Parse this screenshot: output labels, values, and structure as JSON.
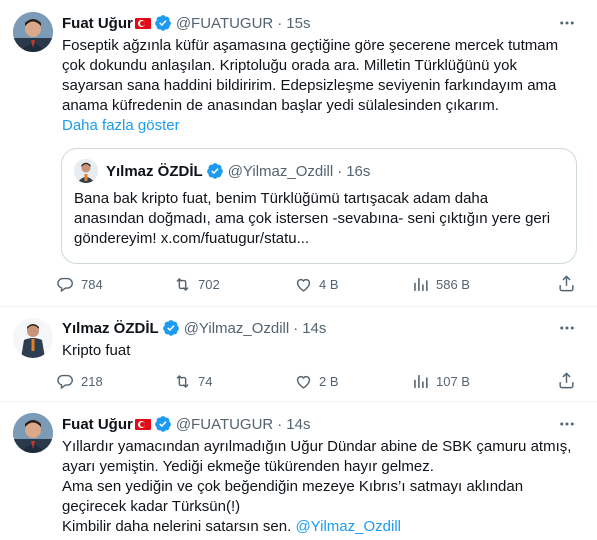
{
  "tweets": [
    {
      "name": "Fuat Uğur",
      "flag": true,
      "handle": "@FUATUGUR",
      "separator": "·",
      "time": "15s",
      "lines": [
        "Foseptik ağzınla küfür aşamasına geçtiğine göre şecerene mercek tutmam",
        "çok dokundu anlaşılan. Kriptoluğu orada ara.  Milletin Türklüğünü yok",
        "sayarsan sana haddini bildiririm. Edepsizleşme seviyenin farkındayım ama",
        "anama küfredenin de anasından başlar yedi sülalesinden çıkarım."
      ],
      "show_more": "Daha fazla göster",
      "quote": {
        "name": "Yılmaz ÖZDİL",
        "handle": "@Yilmaz_Ozdill",
        "separator": "·",
        "time": "16s",
        "lines": [
          "Bana bak kripto fuat, benim Türklüğümü tartışacak adam daha",
          "anasından doğmadı, ama çok istersen -sevabına- seni çıktığın yere geri",
          "göndereyim! x.com/fuatugur/statu..."
        ]
      },
      "stats": {
        "replies": "784",
        "reposts": "702",
        "likes": "4 B",
        "views": "586 B"
      }
    },
    {
      "name": "Yılmaz ÖZDİL",
      "handle": "@Yilmaz_Ozdill",
      "separator": "·",
      "time": "14s",
      "lines": [
        "Kripto fuat"
      ],
      "stats": {
        "replies": "218",
        "reposts": "74",
        "likes": "2 B",
        "views": "107 B"
      }
    },
    {
      "name": "Fuat Uğur",
      "flag": true,
      "handle": "@FUATUGUR",
      "separator": "·",
      "time": "14s",
      "lines": [
        "Yıllardır yamacından ayrılmadığın Uğur Dündar abine de SBK çamuru atmış,",
        "ayarı yemiştin. Yediği ekmeğe tükürenden hayır gelmez.",
        "Ama sen yediğin ve çok beğendiğin mezeye Kıbrıs’ı satmayı aklından",
        "geçirecek kadar Türksün(!)"
      ],
      "last_line_text": "Kimbilir daha nelerini satarsın sen. ",
      "last_line_mention": "@Yilmaz_Ozdill"
    }
  ],
  "icons": {
    "verified": "verified-badge-icon",
    "more": "more-horizontal-icon",
    "reply": "reply-icon",
    "repost": "repost-icon",
    "like": "like-heart-icon",
    "views": "views-chart-icon",
    "share": "share-icon"
  },
  "colors": {
    "accent": "#1d9bf0",
    "muted": "#536471",
    "text": "#0f1419",
    "border": "#cfd9de"
  }
}
